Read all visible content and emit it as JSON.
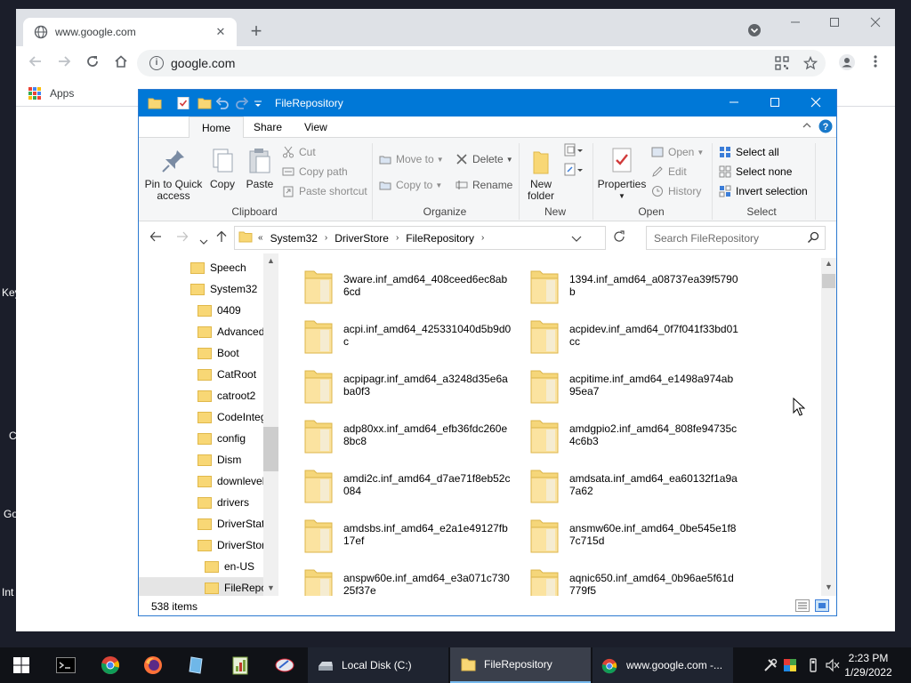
{
  "desktop": {
    "fragments": [
      "Key",
      "C",
      "Go",
      "Int"
    ]
  },
  "browser": {
    "tab_title": "www.google.com",
    "tab_close": "✕",
    "new_tab": "+",
    "url": "google.com",
    "bookmarks": {
      "apps_label": "Apps"
    }
  },
  "explorer": {
    "title": "FileRepository",
    "ribbon_tabs": [
      "Home",
      "Share",
      "View"
    ],
    "clipboard": {
      "pin_label": "Pin to Quick access",
      "copy_label": "Copy",
      "paste_label": "Paste",
      "cut_label": "Cut",
      "copy_path_label": "Copy path",
      "paste_shortcut_label": "Paste shortcut",
      "group_label": "Clipboard"
    },
    "organize": {
      "move_to_label": "Move to",
      "copy_to_label": "Copy to",
      "delete_label": "Delete",
      "rename_label": "Rename",
      "group_label": "Organize"
    },
    "new": {
      "new_folder_label": "New folder",
      "group_label": "New"
    },
    "open": {
      "properties_label": "Properties",
      "open_label": "Open",
      "edit_label": "Edit",
      "history_label": "History",
      "group_label": "Open"
    },
    "select": {
      "select_all_label": "Select all",
      "select_none_label": "Select none",
      "invert_label": "Invert selection",
      "group_label": "Select"
    },
    "address": {
      "overflow": "«",
      "segments": [
        "System32",
        "DriverStore",
        "FileRepository"
      ]
    },
    "search_placeholder": "Search FileRepository",
    "nav_tree": [
      {
        "label": "Speech",
        "indent": 0
      },
      {
        "label": "System32",
        "indent": 0
      },
      {
        "label": "0409",
        "indent": 1
      },
      {
        "label": "Advanced",
        "indent": 1
      },
      {
        "label": "Boot",
        "indent": 1
      },
      {
        "label": "CatRoot",
        "indent": 1
      },
      {
        "label": "catroot2",
        "indent": 1
      },
      {
        "label": "CodeInteg",
        "indent": 1
      },
      {
        "label": "config",
        "indent": 1
      },
      {
        "label": "Dism",
        "indent": 1
      },
      {
        "label": "downlevel",
        "indent": 1
      },
      {
        "label": "drivers",
        "indent": 1
      },
      {
        "label": "DriverState",
        "indent": 1
      },
      {
        "label": "DriverStore",
        "indent": 1
      },
      {
        "label": "en-US",
        "indent": 2
      },
      {
        "label": "FileRepo",
        "indent": 2,
        "selected": true
      }
    ],
    "files": [
      "3ware.inf_amd64_408ceed6ec8ab6cd",
      "1394.inf_amd64_a08737ea39f5790b",
      "acpi.inf_amd64_425331040d5b9d0c",
      "acpidev.inf_amd64_0f7f041f33bd01cc",
      "acpipagr.inf_amd64_a3248d35e6aba0f3",
      "acpitime.inf_amd64_e1498a974ab95ea7",
      "adp80xx.inf_amd64_efb36fdc260e8bc8",
      "amdgpio2.inf_amd64_808fe94735c4c6b3",
      "amdi2c.inf_amd64_d7ae71f8eb52c084",
      "amdsata.inf_amd64_ea60132f1a9a7a62",
      "amdsbs.inf_amd64_e2a1e49127fb17ef",
      "ansmw60e.inf_amd64_0be545e1f87c715d",
      "anspw60e.inf_amd64_e3a071c73025f37e",
      "aqnic650.inf_amd64_0b96ae5f61d779f5"
    ],
    "status_count": "538 items"
  },
  "taskbar": {
    "apps": [
      {
        "label": "Local Disk (C:)"
      },
      {
        "label": "FileRepository"
      },
      {
        "label": "www.google.com -..."
      }
    ],
    "time": "2:23 PM",
    "date": "1/29/2022"
  },
  "colors": {
    "explorer_title": "#0078d7",
    "folder": "#f8d775",
    "chrome_frame": "#dee1e6",
    "taskbar": "#101217"
  }
}
